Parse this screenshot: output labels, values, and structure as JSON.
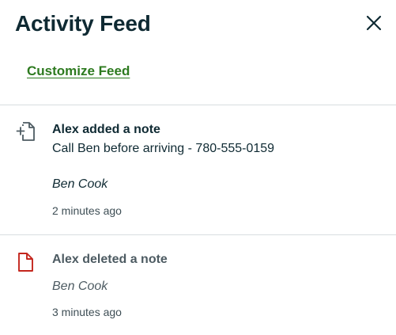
{
  "header": {
    "title": "Activity Feed"
  },
  "actions": {
    "customize_label": "Customize Feed"
  },
  "feed": {
    "items": [
      {
        "icon": "add-note-icon",
        "title": "Alex added a note",
        "body": "Call Ben before arriving - 780-555-0159",
        "person": "Ben Cook",
        "time": "2 minutes ago",
        "title_color": "#0f2a33",
        "person_color": "#0f2a33"
      },
      {
        "icon": "deleted-note-icon",
        "title": "Alex deleted a note",
        "person": "Ben Cook",
        "time": "3 minutes ago",
        "title_color": "#4d5b62",
        "person_color": "#4d5b62",
        "icon_color": "#c4261d"
      }
    ]
  },
  "colors": {
    "link": "#2d7a1f",
    "text": "#0f2a33",
    "muted": "#4d5b62",
    "danger": "#c4261d",
    "divider": "#d8dde0"
  }
}
